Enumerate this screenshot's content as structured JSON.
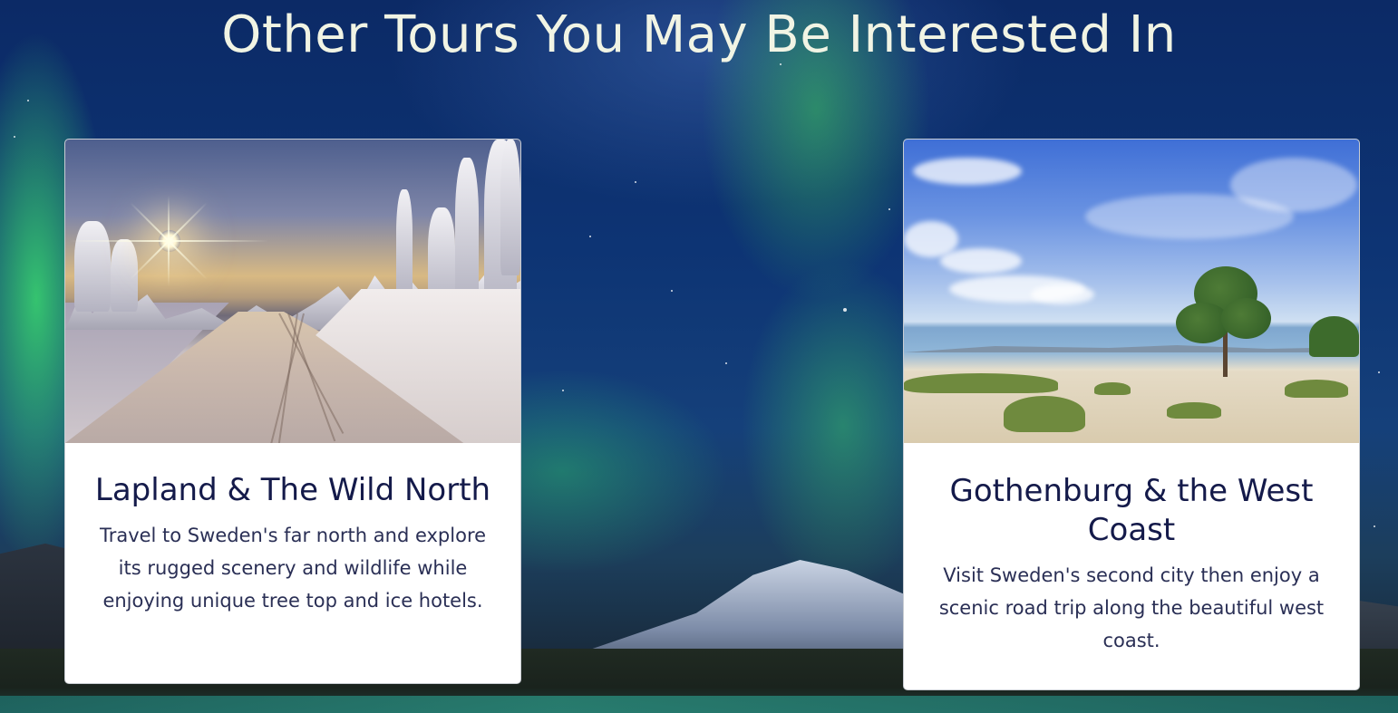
{
  "section": {
    "title": "Other Tours You May Be Interested In"
  },
  "tours": [
    {
      "title": "Lapland & The Wild North",
      "description": "Travel to Sweden's far north and explore its rugged scenery and wildlife while enjoying unique tree top and ice hotels.",
      "image_alt": "Snowy road through frosted forest at sunset"
    },
    {
      "title": "Gothenburg & the West Coast",
      "description": "Visit Sweden's second city then enjoy a scenic road trip along the beautiful west coast.",
      "image_alt": "Sandy beach with a pine tree by the sea"
    }
  ],
  "colors": {
    "title_text": "#f1f4e4",
    "card_title": "#141a4a",
    "card_text": "#2a2f55",
    "card_bg": "#ffffff"
  }
}
